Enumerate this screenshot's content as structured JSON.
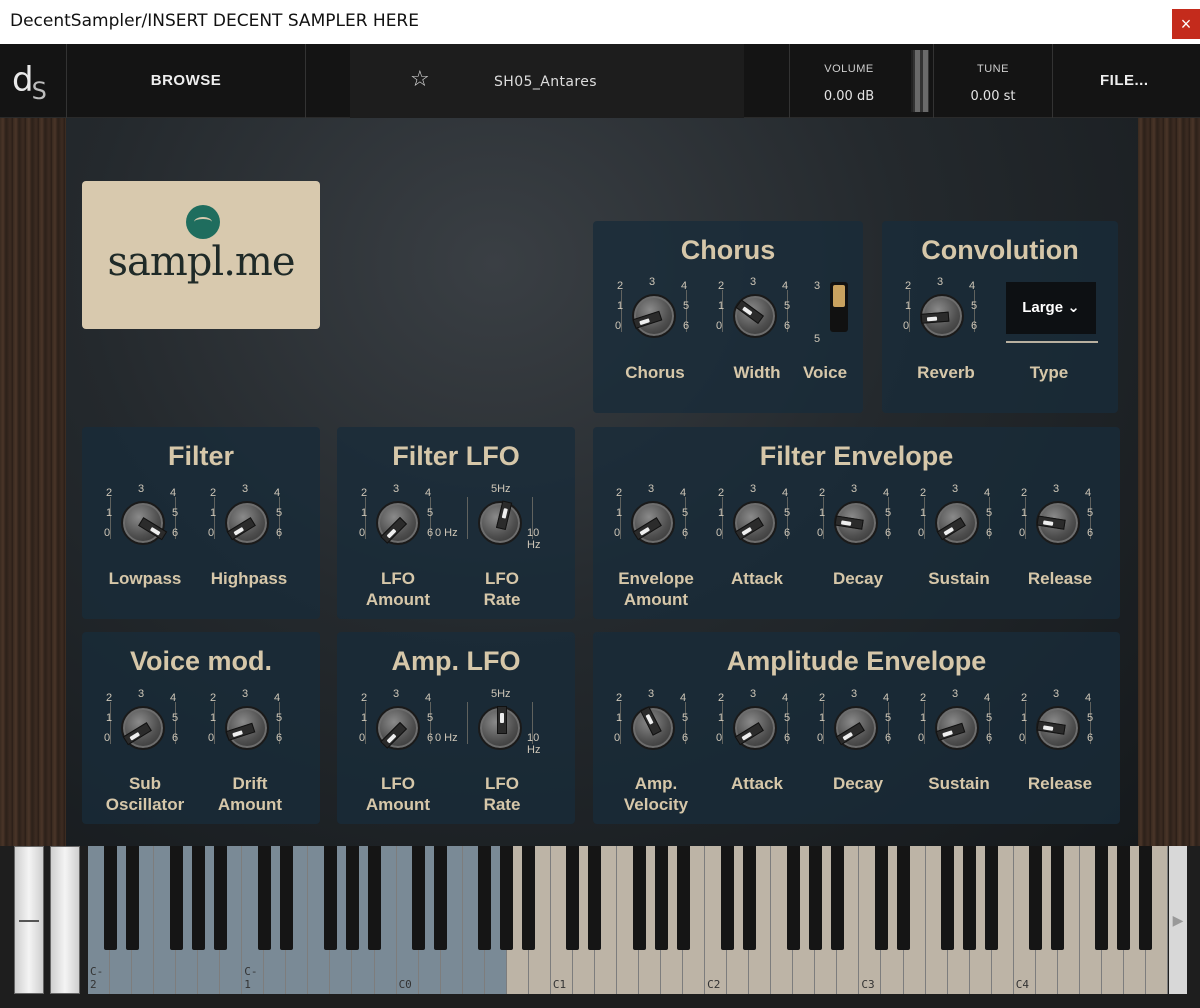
{
  "window": {
    "title": "DecentSampler/INSERT DECENT SAMPLER HERE",
    "close_glyph": "×"
  },
  "topbar": {
    "logo_main": "d",
    "logo_sub": "S",
    "browse": "BROWSE",
    "preset": "SH05_Antares",
    "volume_label": "VOLUME",
    "volume_value": "0.00 dB",
    "tune_label": "TUNE",
    "tune_value": "0.00 st",
    "file": "FILE..."
  },
  "brand": {
    "name": "sampl.me"
  },
  "scale": {
    "n0": "0",
    "n1": "1",
    "n2": "2",
    "n3": "3",
    "n4": "4",
    "n5": "5",
    "n6": "6"
  },
  "rate_scale": {
    "min": "0 Hz",
    "mid": "5Hz",
    "max": "10 Hz"
  },
  "chorus": {
    "title": "Chorus",
    "chorus_label": "Chorus",
    "width_label": "Width",
    "voice_label": "Voice",
    "voice_top": "3",
    "voice_bottom": "5",
    "voice_value": 3,
    "chorus_value": 0.1,
    "width_value": 0.3
  },
  "convolution": {
    "title": "Convolution",
    "reverb_label": "Reverb",
    "type_label": "Type",
    "type_value": "Large",
    "reverb_value": 0.15
  },
  "filter": {
    "title": "Filter",
    "lowpass_label": "Lowpass",
    "highpass_label": "Highpass",
    "lowpass_value": 0.95,
    "highpass_value": 0.05
  },
  "filter_lfo": {
    "title": "Filter LFO",
    "amount_label": "LFO\nAmount",
    "rate_label": "LFO\nRate",
    "amount_value": 0.0,
    "rate_value": 0.55
  },
  "filter_env": {
    "title": "Filter Envelope",
    "labels": [
      "Envelope\nAmount",
      "Attack",
      "Decay",
      "Sustain",
      "Release"
    ],
    "values": [
      0.05,
      0.05,
      0.2,
      0.05,
      0.2
    ]
  },
  "voice_mod": {
    "title": "Voice mod.",
    "sub_label": "Sub\nOscillator",
    "drift_label": "Drift\nAmount",
    "sub_value": 0.05,
    "drift_value": 0.1
  },
  "amp_lfo": {
    "title": "Amp. LFO",
    "amount_label": "LFO\nAmount",
    "rate_label": "LFO\nRate",
    "amount_value": 0.0,
    "rate_value": 0.5
  },
  "amp_env": {
    "title": "Amplitude Envelope",
    "labels": [
      "Amp.\nVelocity",
      "Attack",
      "Decay",
      "Sustain",
      "Release"
    ],
    "values": [
      0.4,
      0.05,
      0.05,
      0.1,
      0.2
    ]
  },
  "keyboard": {
    "octave_labels": [
      "C-2",
      "C-1",
      "C0",
      "C1",
      "C2",
      "C3",
      "C4"
    ],
    "colors": {
      "inactive_white": "#7a8a96",
      "active_white": "#bdb4a6",
      "black": "#151515"
    },
    "scroll_glyph": "▶"
  },
  "colors": {
    "accent": "#d6c7a9",
    "panel": "#182c3a",
    "brand_bg": "#d8c9ae",
    "brand_dot": "#1f6d5e",
    "close": "#c42b1c"
  }
}
